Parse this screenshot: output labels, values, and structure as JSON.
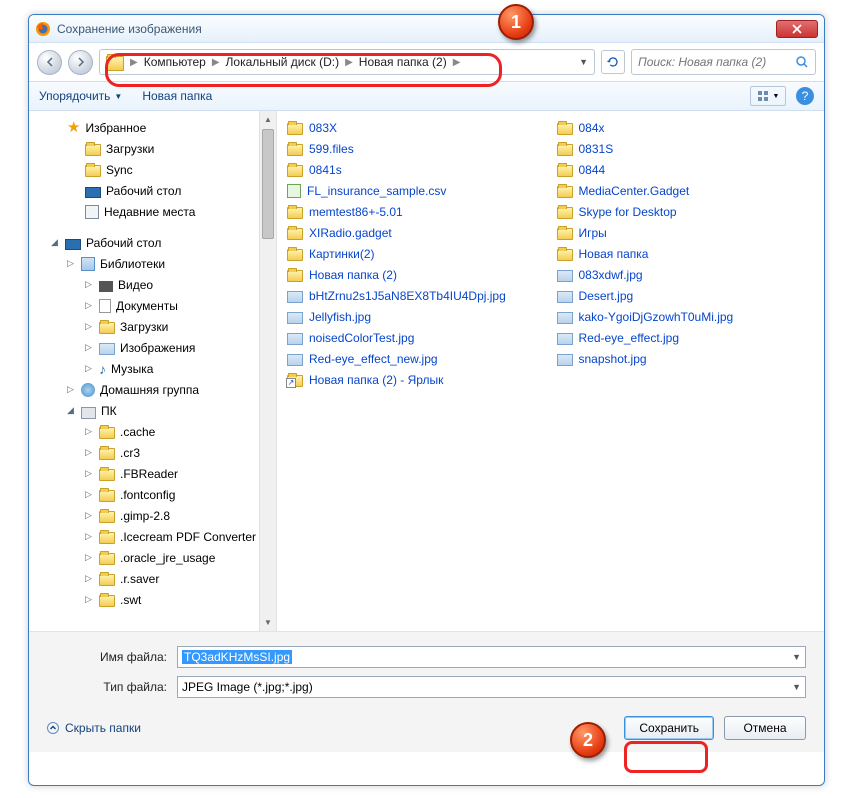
{
  "window": {
    "title": "Сохранение изображения"
  },
  "breadcrumb": {
    "root": "Компьютер",
    "drive": "Локальный диск (D:)",
    "folder": "Новая папка (2)"
  },
  "search": {
    "placeholder": "Поиск: Новая папка (2)"
  },
  "toolbar": {
    "organize": "Упорядочить",
    "new_folder": "Новая папка"
  },
  "sidebar": {
    "favorites": "Избранное",
    "downloads": "Загрузки",
    "sync": "Sync",
    "desktop_fav": "Рабочий стол",
    "recent": "Недавние места",
    "desktop": "Рабочий стол",
    "libraries": "Библиотеки",
    "video": "Видео",
    "documents": "Документы",
    "downloads2": "Загрузки",
    "images": "Изображения",
    "music": "Музыка",
    "homegroup": "Домашняя группа",
    "pc": "ПК",
    "folders": [
      ".cache",
      ".cr3",
      ".FBReader",
      ".fontconfig",
      ".gimp-2.8",
      ".Icecream PDF Converter",
      ".oracle_jre_usage",
      ".r.saver",
      ".swt"
    ]
  },
  "files": {
    "col1": [
      {
        "t": "folder",
        "n": "083X"
      },
      {
        "t": "folder",
        "n": "599.files"
      },
      {
        "t": "folder",
        "n": "0841s"
      },
      {
        "t": "csv",
        "n": "FL_insurance_sample.csv"
      },
      {
        "t": "folder",
        "n": "memtest86+-5.01"
      },
      {
        "t": "folder",
        "n": "XIRadio.gadget"
      },
      {
        "t": "folder",
        "n": "Картинки(2)"
      },
      {
        "t": "folder",
        "n": "Новая папка (2)"
      },
      {
        "t": "img",
        "n": "bHtZrnu2s1J5aN8EX8Tb4IU4Dpj.jpg"
      },
      {
        "t": "img",
        "n": "Jellyfish.jpg"
      },
      {
        "t": "img",
        "n": "noisedColorTest.jpg"
      },
      {
        "t": "img",
        "n": "Red-eye_effect_new.jpg"
      },
      {
        "t": "shortcut",
        "n": "Новая папка (2) - Ярлык"
      }
    ],
    "col2": [
      {
        "t": "folder",
        "n": "084x"
      },
      {
        "t": "folder",
        "n": "0831S"
      },
      {
        "t": "folder",
        "n": "0844"
      },
      {
        "t": "folder",
        "n": "MediaCenter.Gadget"
      },
      {
        "t": "folder",
        "n": "Skype for Desktop"
      },
      {
        "t": "folder",
        "n": "Игры"
      },
      {
        "t": "folder",
        "n": "Новая папка"
      },
      {
        "t": "img",
        "n": "083xdwf.jpg"
      },
      {
        "t": "img",
        "n": "Desert.jpg"
      },
      {
        "t": "img",
        "n": "kako-YgoiDjGzowhT0uMi.jpg"
      },
      {
        "t": "img",
        "n": "Red-eye_effect.jpg"
      },
      {
        "t": "img",
        "n": "snapshot.jpg"
      }
    ]
  },
  "form": {
    "filename_label": "Имя файла:",
    "filename_value": "TQ3adKHzMsSI.jpg",
    "filetype_label": "Тип файла:",
    "filetype_value": "JPEG Image (*.jpg;*.jpg)"
  },
  "actions": {
    "hide_folders": "Скрыть папки",
    "save": "Сохранить",
    "cancel": "Отмена"
  },
  "markers": {
    "m1": "1",
    "m2": "2"
  }
}
